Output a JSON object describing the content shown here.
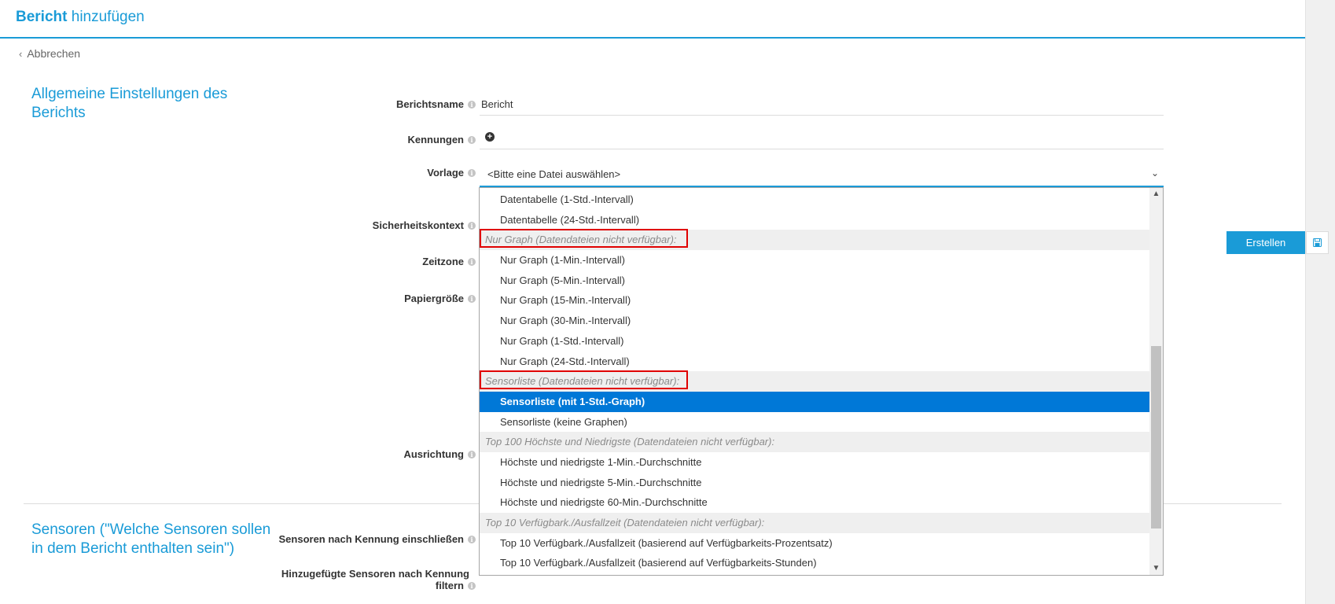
{
  "header": {
    "title_bold": "Bericht",
    "title_rest": "hinzufügen"
  },
  "back": {
    "label": "Abbrechen"
  },
  "section1": {
    "title": "Allgemeine Einstellungen des Berichts"
  },
  "section2": {
    "title": "Sensoren (\"Welche Sensoren sollen in dem Bericht enthalten sein\")"
  },
  "fields": {
    "name": {
      "label": "Berichtsname",
      "value": "Bericht"
    },
    "tags": {
      "label": "Kennungen"
    },
    "template": {
      "label": "Vorlage",
      "value": "<Bitte eine Datei auswählen>"
    },
    "security": {
      "label": "Sicherheitskontext"
    },
    "timezone": {
      "label": "Zeitzone"
    },
    "paper": {
      "label": "Papiergröße"
    },
    "orientation": {
      "label": "Ausrichtung"
    },
    "include_tags": {
      "label": "Sensoren nach Kennung einschließen"
    },
    "filter_tags": {
      "label_line1": "Hinzugefügte Sensoren nach Kennung",
      "label_line2": "filtern"
    }
  },
  "actions": {
    "create_label": "Erstellen",
    "save_icon": "save-icon"
  },
  "dropdown": {
    "options": [
      {
        "label": "Datentabelle (1-Std.-Intervall)",
        "type": "item"
      },
      {
        "label": "Datentabelle (24-Std.-Intervall)",
        "type": "item"
      },
      {
        "label": "Nur Graph (Datendateien nicht verfügbar):",
        "type": "group",
        "highlighted": true
      },
      {
        "label": "Nur Graph (1-Min.-Intervall)",
        "type": "item"
      },
      {
        "label": "Nur Graph (5-Min.-Intervall)",
        "type": "item"
      },
      {
        "label": "Nur Graph (15-Min.-Intervall)",
        "type": "item"
      },
      {
        "label": "Nur Graph (30-Min.-Intervall)",
        "type": "item"
      },
      {
        "label": "Nur Graph (1-Std.-Intervall)",
        "type": "item"
      },
      {
        "label": "Nur Graph (24-Std.-Intervall)",
        "type": "item"
      },
      {
        "label": "Sensorliste (Datendateien nicht verfügbar):",
        "type": "group",
        "highlighted": true
      },
      {
        "label": "Sensorliste (mit 1-Std.-Graph)",
        "type": "item",
        "selected": true
      },
      {
        "label": "Sensorliste (keine Graphen)",
        "type": "item"
      },
      {
        "label": "Top 100 Höchste und Niedrigste (Datendateien nicht verfügbar):",
        "type": "group"
      },
      {
        "label": "Höchste und niedrigste 1-Min.-Durchschnitte",
        "type": "item"
      },
      {
        "label": "Höchste und niedrigste 5-Min.-Durchschnitte",
        "type": "item"
      },
      {
        "label": "Höchste und niedrigste 60-Min.-Durchschnitte",
        "type": "item"
      },
      {
        "label": "Top 10 Verfügbark./Ausfallzeit (Datendateien nicht verfügbar):",
        "type": "group"
      },
      {
        "label": "Top 10 Verfügbark./Ausfallzeit (basierend auf Verfügbarkeits-Prozentsatz)",
        "type": "item"
      },
      {
        "label": "Top 10 Verfügbark./Ausfallzeit (basierend auf Verfügbarkeits-Stunden)",
        "type": "item"
      }
    ]
  },
  "colors": {
    "accent": "#1a9bd7",
    "selected": "#0078d7",
    "highlight_box": "#e00000"
  }
}
